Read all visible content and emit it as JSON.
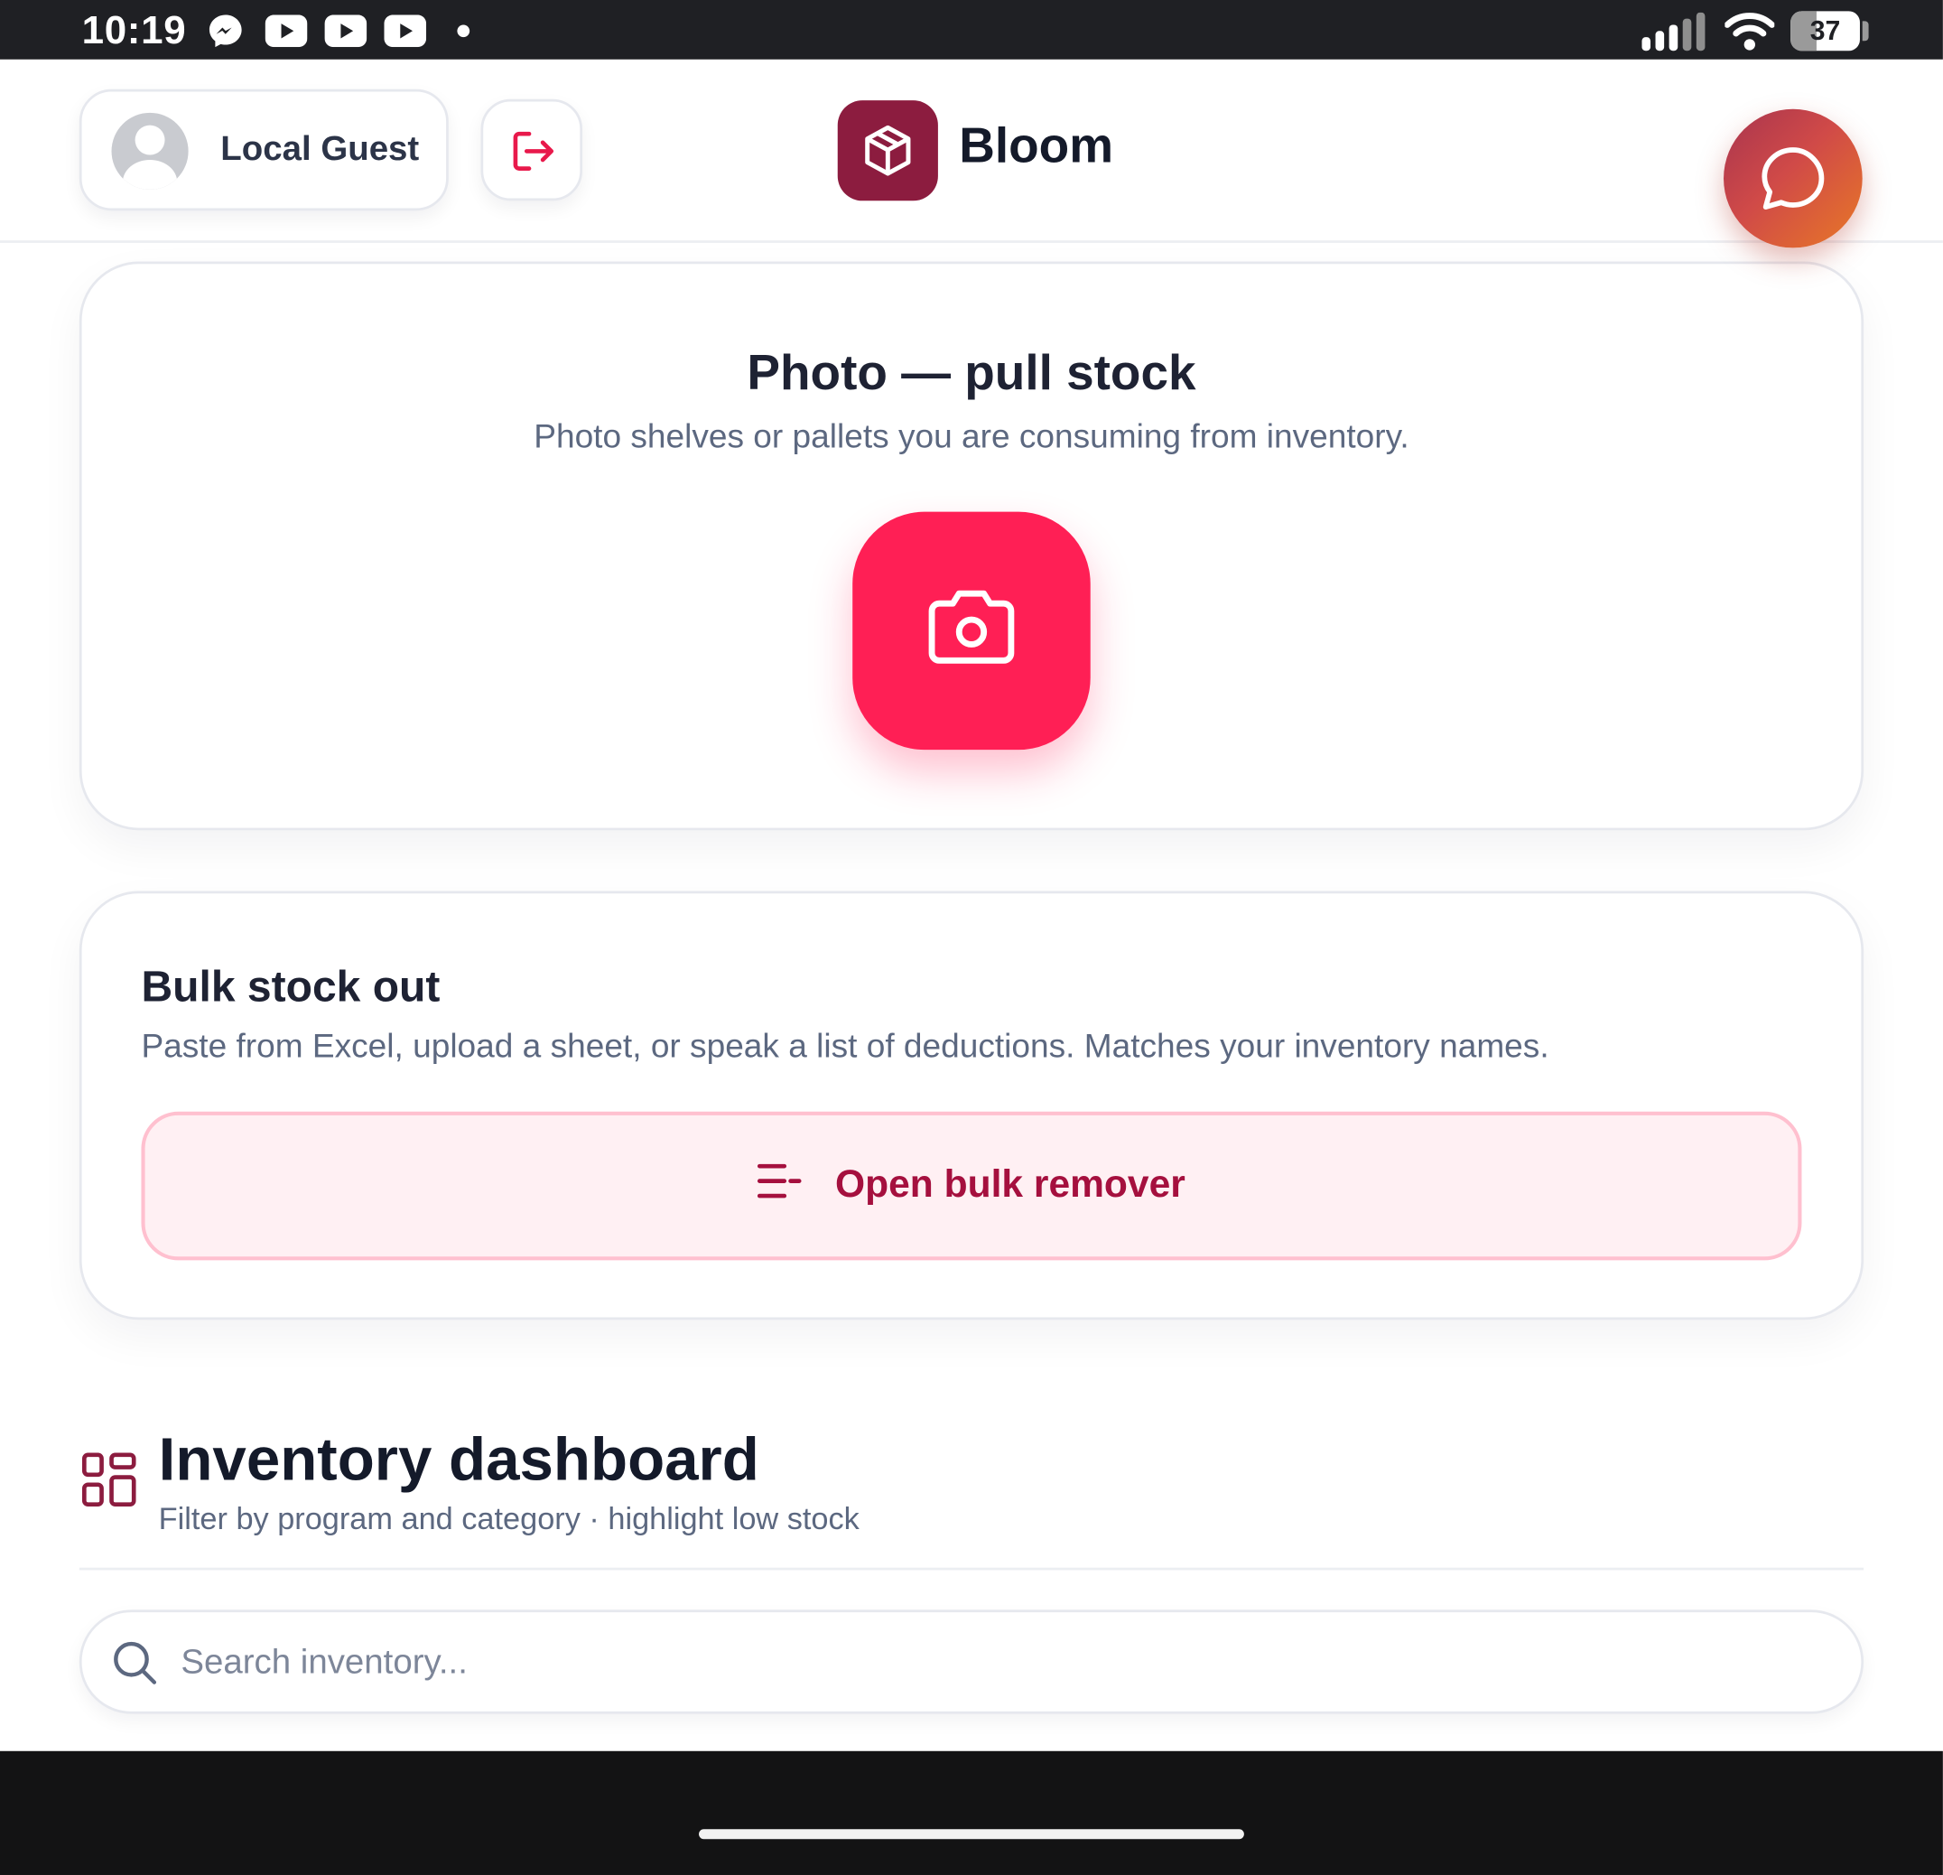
{
  "status_bar": {
    "time": "10:19",
    "battery": "37",
    "battery_level": 0.37,
    "notification_icons": [
      "messenger-icon",
      "youtube-icon",
      "youtube-icon",
      "youtube-icon"
    ]
  },
  "header": {
    "user_name": "Local Guest",
    "brand_name": "Bloom",
    "brand_color": "#8c1c3f",
    "chat_gradient": [
      "#a8344e",
      "#e87826"
    ]
  },
  "photo_card": {
    "title": "Photo — pull stock",
    "subtitle": "Photo shelves or pallets you are consuming from inventory.",
    "camera_color": "#ff1f55"
  },
  "bulk_card": {
    "title": "Bulk stock out",
    "subtitle": "Paste from Excel, upload a sheet, or speak a list of deductions. Matches your inventory names.",
    "button_label": "Open bulk remover"
  },
  "dashboard": {
    "title": "Inventory dashboard",
    "subtitle": "Filter by program and category · highlight low stock",
    "search_placeholder": "Search inventory..."
  },
  "colors": {
    "accent": "#ff1f55",
    "accent_dark": "#a5103e",
    "text_primary": "#1e2233",
    "text_secondary": "#5c6880"
  }
}
